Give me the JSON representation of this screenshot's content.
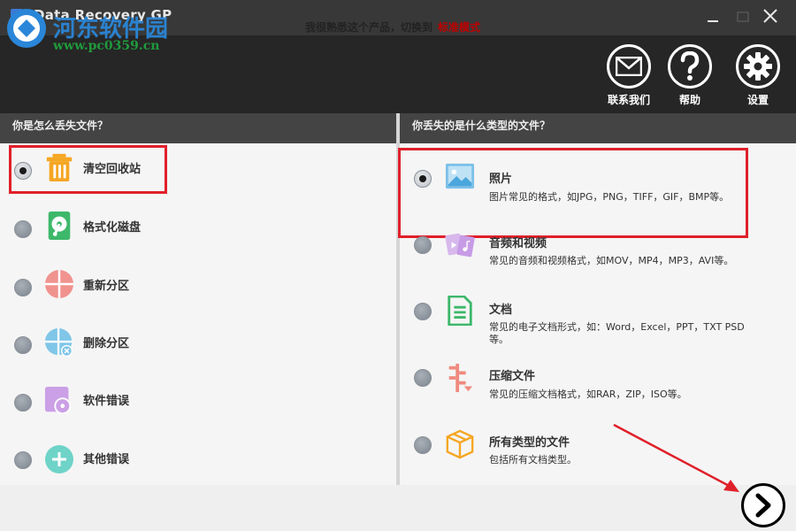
{
  "app": {
    "title": "Data Recovery  GP",
    "watermark_text": "河东软件园",
    "watermark_url": "www.pc0359.cn"
  },
  "header": {
    "buttons": [
      {
        "label": "联系我们",
        "icon": "mail-icon"
      },
      {
        "label": "帮助",
        "icon": "question-icon"
      },
      {
        "label": "设置",
        "icon": "gear-icon"
      }
    ]
  },
  "left": {
    "title": "你是怎么丢失文件？",
    "items": [
      {
        "label": "清空回收站",
        "icon": "trash-icon",
        "selected": true
      },
      {
        "label": "格式化磁盘",
        "icon": "disk-icon",
        "selected": false
      },
      {
        "label": "重新分区",
        "icon": "partition-icon",
        "selected": false
      },
      {
        "label": "删除分区",
        "icon": "delete-partition-icon",
        "selected": false
      },
      {
        "label": "软件错误",
        "icon": "software-error-icon",
        "selected": false
      },
      {
        "label": "其他错误",
        "icon": "plus-icon",
        "selected": false
      }
    ]
  },
  "right": {
    "title": "你丢失的是什么类型的文件？",
    "items": [
      {
        "label": "照片",
        "desc": "图片常见的格式，如JPG，PNG，TIFF，GIF，BMP等。",
        "icon": "photo-icon",
        "selected": true
      },
      {
        "label": "音频和视频",
        "desc": "常见的音频和视频格式，如MOV，MP4，MP3，AVI等。",
        "icon": "media-icon",
        "selected": false
      },
      {
        "label": "文档",
        "desc": "常见的电子文档形式，如：Word，Excel，PPT，TXT PSD等。",
        "icon": "document-icon",
        "selected": false
      },
      {
        "label": "压缩文件",
        "desc": "常见的压缩文档格式，如RAR，ZIP，ISO等。",
        "icon": "archive-icon",
        "selected": false
      },
      {
        "label": "所有类型的文件",
        "desc": "包括所有文档类型。",
        "icon": "box-icon",
        "selected": false
      }
    ]
  },
  "footer": {
    "text": "我很熟悉这个产品，切换到",
    "link": "标准模式"
  },
  "colors": {
    "highlight": "#e0202a",
    "header_bg": "#262626",
    "link": "#c00000"
  }
}
